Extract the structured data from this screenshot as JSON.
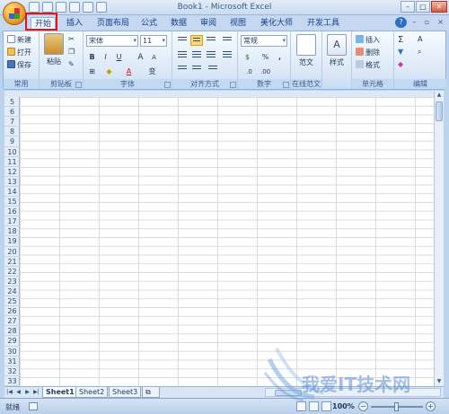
{
  "window": {
    "title": "Book1 - Microsoft Excel",
    "controls": [
      "–",
      "□",
      "✕"
    ]
  },
  "tabs": [
    "开始",
    "插入",
    "页面布局",
    "公式",
    "数据",
    "审阅",
    "视图",
    "美化大师",
    "开发工具"
  ],
  "active_tab": "开始",
  "ribbon": {
    "clipboard": {
      "new": "新建",
      "open": "打开",
      "save": "保存",
      "paste": "粘贴",
      "label": "剪贴板",
      "common_label": "常用"
    },
    "font": {
      "name": "宋体",
      "size": "11",
      "bold": "B",
      "italic": "I",
      "underline": "U",
      "grow": "A",
      "shrink": "A",
      "color_letter": "A",
      "phonetic": "变",
      "label": "字体"
    },
    "alignment": {
      "label": "对齐方式"
    },
    "number": {
      "format": "常规",
      "percent": "%",
      "comma": ",",
      "label": "数字"
    },
    "template": {
      "label": "范文",
      "group_label": "在线范文"
    },
    "styles": {
      "label": "样式"
    },
    "cells": {
      "insert": "插入",
      "delete": "删除",
      "format": "格式",
      "label": "单元格"
    },
    "editing": {
      "sum": "Σ",
      "sort": "A",
      "label": "编辑"
    }
  },
  "rows": [
    "5",
    "6",
    "7",
    "8",
    "9",
    "10",
    "11",
    "12",
    "13",
    "14",
    "15",
    "16",
    "17",
    "18",
    "19",
    "20",
    "21",
    "22",
    "23",
    "24",
    "25",
    "26",
    "27",
    "28",
    "29",
    "30",
    "31",
    "32",
    "33"
  ],
  "sheets": [
    "Sheet1",
    "Sheet2",
    "Sheet3"
  ],
  "active_sheet": "Sheet1",
  "status": {
    "text": "就绪",
    "zoom": "100%"
  },
  "watermark": "我爱IT技术网",
  "colors": {
    "accent": "#15428b",
    "highlight_box": "#e3141c",
    "ribbon_bg": "#dbe8f7"
  }
}
